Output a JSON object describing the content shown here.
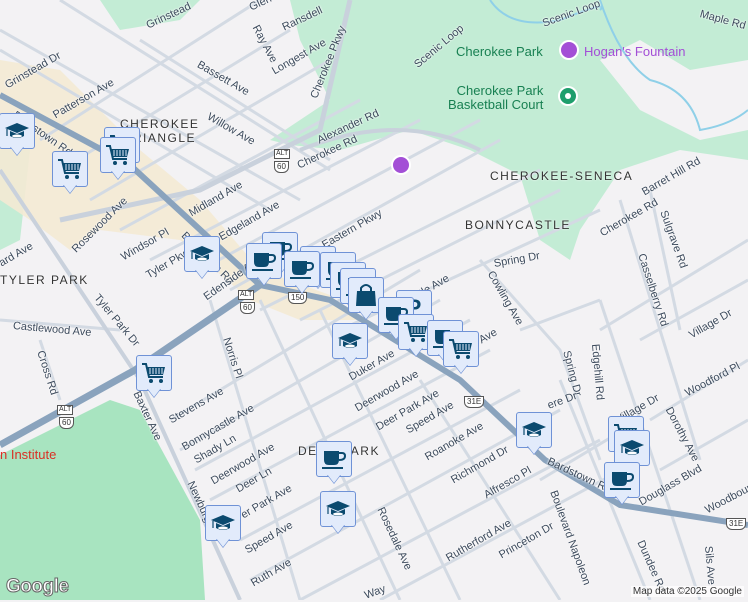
{
  "neighborhoods": [
    "CHEROKEE",
    "TRIANGLE",
    "TYLER PARK",
    "CHEROKEE-SENECA",
    "BONNYCASTLE",
    "DEER PARK"
  ],
  "parks": [
    "Cherokee Park",
    "Cherokee Park",
    "Basketball Court"
  ],
  "poi": {
    "hogans_fountain": "Hogan's Fountain",
    "institute": "n Institute"
  },
  "streets": [
    "Grinstead Dr",
    "Grinstead",
    "Glen",
    "Ray Ave",
    "Ransdell",
    "Longest Ave",
    "Bassett Ave",
    "Cherokee Pkwy",
    "Patterson Ave",
    "Willow Ave",
    "Alexander Rd",
    "Cherokee Rd",
    "Bardstown Rd",
    "Rosewood Ave",
    "Midland Ave",
    "Edgeland Ave",
    "Windsor Pl",
    "Tyler Pkwy",
    "Bardstown Rd",
    "Edenside Ave",
    "Eastern Pkwy",
    "ard Ave",
    "Tyler Park Dr",
    "Castlewood Ave",
    "Cross Rd",
    "Norris Pl",
    "Stevens Ave",
    "Bonnycastle Ave",
    "Shady Ln",
    "Deerwood Ave",
    "Deer Ln",
    "er Park Ave",
    "Speed Ave",
    "Ruth Ave",
    "Baxter Ave",
    "Newburg",
    "Rosedale Ave",
    "Duker Ave",
    "Deerwood Ave",
    "Deer Park Ave",
    "Speed Ave",
    "Roanoke Ave",
    "Richmond Dr",
    "Alfresco Pl",
    "Rutherford Ave",
    "Princeton Dr",
    "Boulevard Napoleon",
    "Dundee Rd",
    "Sils Ave",
    "Douglass Blvd",
    "Woodbourne",
    "Village Dr",
    "Village Dr",
    "Woodford Pl",
    "Dorothy Ave",
    "Edgehill Rd",
    "Spring Dr",
    "Spring Dr",
    "Cowling Ave",
    "Casselberry Rd",
    "Sulgrave Rd",
    "Cherokee Rd",
    "Barret Hill Rd",
    "Bardstown Rd",
    "ere Dr",
    "tle Ave",
    "Maple Rd",
    "Scenic Loop",
    "Scenic Loop",
    "Ave",
    "Way"
  ],
  "shields": {
    "alt": "ALT",
    "us60": "60",
    "us150": "150",
    "us31e": "31E"
  },
  "attribution": {
    "logo": "Google",
    "copyright": "Map data ©2025 Google"
  },
  "colors": {
    "park": "#c3ecd5",
    "cemetery": "#a8e4c0",
    "major_road": "#8aa3bd",
    "marker_bg": "#e2ebfb",
    "marker_icon": "#0b4a6f"
  }
}
